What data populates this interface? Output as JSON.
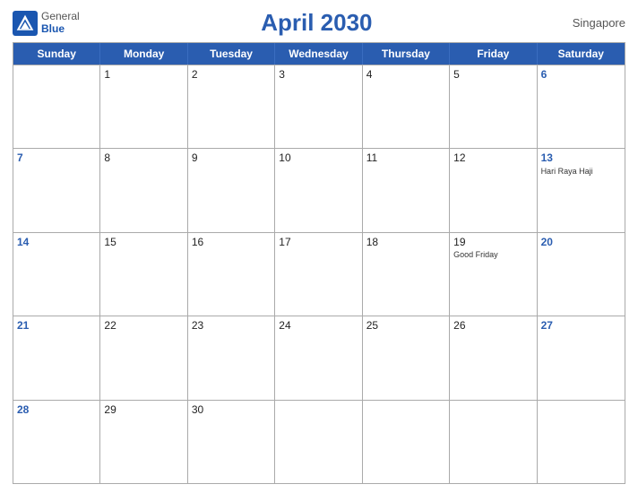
{
  "header": {
    "logo": {
      "text_general": "General",
      "text_blue": "Blue"
    },
    "title": "April 2030",
    "region": "Singapore"
  },
  "days_of_week": [
    "Sunday",
    "Monday",
    "Tuesday",
    "Wednesday",
    "Thursday",
    "Friday",
    "Saturday"
  ],
  "weeks": [
    [
      {
        "num": "",
        "day_type": "sunday",
        "empty": true
      },
      {
        "num": "1",
        "day_type": "weekday"
      },
      {
        "num": "2",
        "day_type": "weekday"
      },
      {
        "num": "3",
        "day_type": "weekday"
      },
      {
        "num": "4",
        "day_type": "weekday"
      },
      {
        "num": "5",
        "day_type": "weekday"
      },
      {
        "num": "6",
        "day_type": "saturday"
      }
    ],
    [
      {
        "num": "7",
        "day_type": "sunday"
      },
      {
        "num": "8",
        "day_type": "weekday"
      },
      {
        "num": "9",
        "day_type": "weekday"
      },
      {
        "num": "10",
        "day_type": "weekday"
      },
      {
        "num": "11",
        "day_type": "weekday"
      },
      {
        "num": "12",
        "day_type": "weekday"
      },
      {
        "num": "13",
        "day_type": "saturday",
        "holiday": "Hari Raya Haji"
      }
    ],
    [
      {
        "num": "14",
        "day_type": "sunday"
      },
      {
        "num": "15",
        "day_type": "weekday"
      },
      {
        "num": "16",
        "day_type": "weekday"
      },
      {
        "num": "17",
        "day_type": "weekday"
      },
      {
        "num": "18",
        "day_type": "weekday"
      },
      {
        "num": "19",
        "day_type": "weekday",
        "holiday": "Good Friday"
      },
      {
        "num": "20",
        "day_type": "saturday"
      }
    ],
    [
      {
        "num": "21",
        "day_type": "sunday"
      },
      {
        "num": "22",
        "day_type": "weekday"
      },
      {
        "num": "23",
        "day_type": "weekday"
      },
      {
        "num": "24",
        "day_type": "weekday"
      },
      {
        "num": "25",
        "day_type": "weekday"
      },
      {
        "num": "26",
        "day_type": "weekday"
      },
      {
        "num": "27",
        "day_type": "saturday"
      }
    ],
    [
      {
        "num": "28",
        "day_type": "sunday"
      },
      {
        "num": "29",
        "day_type": "weekday"
      },
      {
        "num": "30",
        "day_type": "weekday"
      },
      {
        "num": "",
        "day_type": "weekday",
        "empty": true
      },
      {
        "num": "",
        "day_type": "weekday",
        "empty": true
      },
      {
        "num": "",
        "day_type": "weekday",
        "empty": true
      },
      {
        "num": "",
        "day_type": "saturday",
        "empty": true
      }
    ]
  ]
}
